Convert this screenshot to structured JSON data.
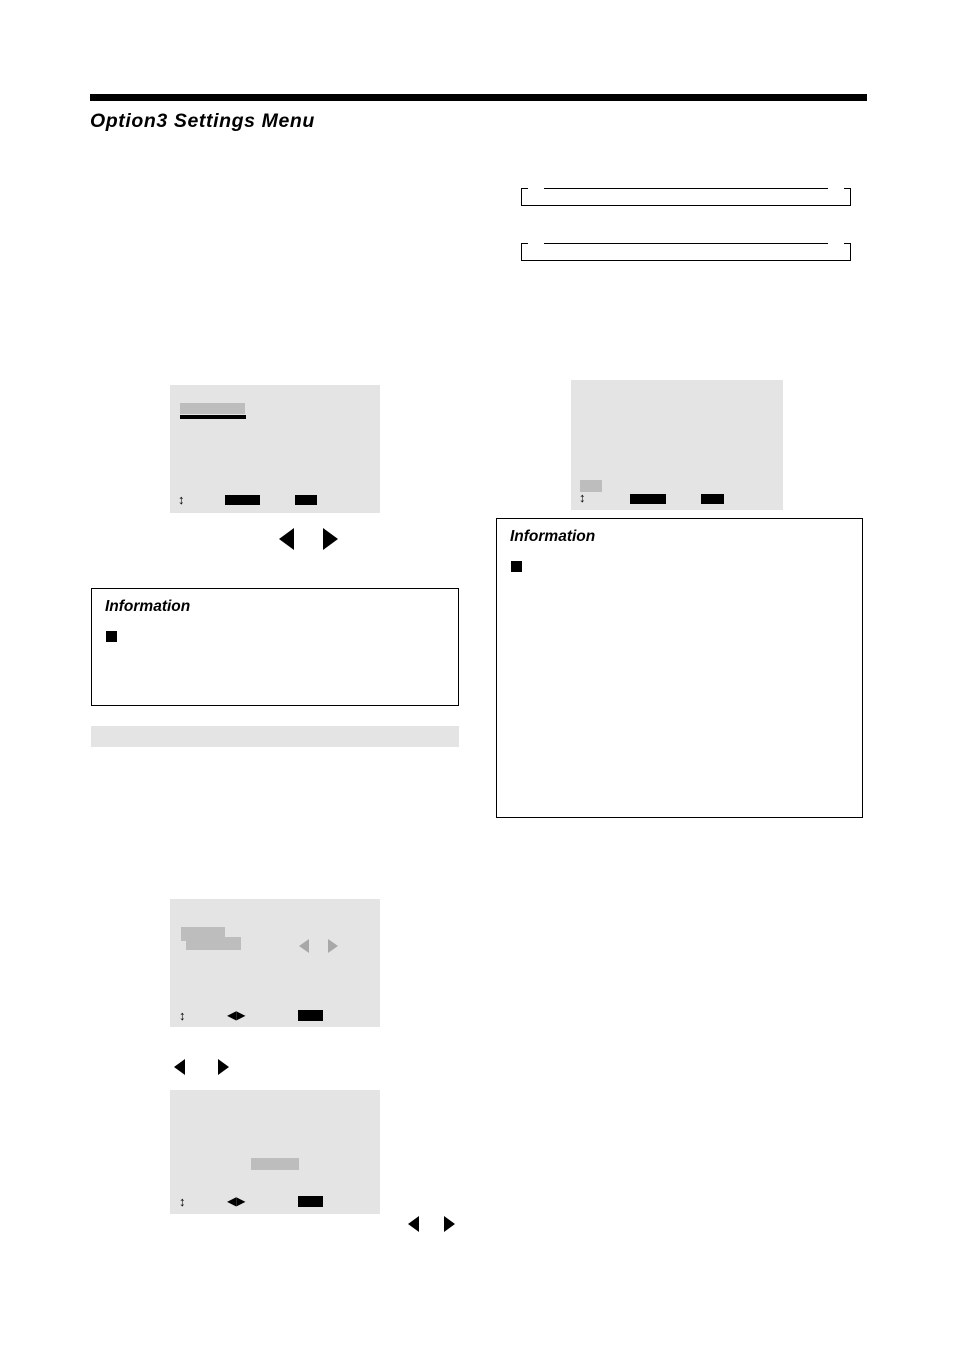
{
  "page": {
    "title": "Option3 Settings Menu",
    "rule_present": true
  },
  "note_boxes": [
    {
      "text": ""
    },
    {
      "text": ""
    }
  ],
  "section_bar": {
    "text": ""
  },
  "paragraphs": {
    "left_intro": "",
    "left_mid": "",
    "right_intro": "",
    "below_panel3": "",
    "below_panel4": ""
  },
  "information_boxes": [
    {
      "name": "information-left",
      "title": "Information",
      "bullet": "■",
      "body": ""
    },
    {
      "name": "information-right",
      "title": "Information",
      "bullet": "■",
      "body": ""
    }
  ],
  "osd_panels": [
    {
      "name": "osd-panel-1",
      "selected_row_label": "",
      "footer": {
        "updown_glyph": "↕",
        "action_1_label": "",
        "action_2_label": ""
      }
    },
    {
      "name": "osd-panel-2",
      "selected_row_label": "",
      "footer": {
        "updown_glyph": "↕",
        "action_1_label": "",
        "action_2_label": ""
      }
    },
    {
      "name": "osd-panel-3",
      "selected_row_label": "",
      "selected_value_label": "",
      "adjust_left_glyph": "◀",
      "adjust_right_glyph": "▶",
      "footer": {
        "updown_glyph": "↕",
        "leftright_glyph": "◀▶",
        "action_label": ""
      }
    },
    {
      "name": "osd-panel-4",
      "selected_value_label": "",
      "footer": {
        "updown_glyph": "↕",
        "leftright_glyph": "◀▶",
        "action_label": ""
      }
    }
  ],
  "nav_arrows": [
    {
      "name": "nav-arrows-under-panel-1",
      "left": "◀",
      "right": "▶"
    },
    {
      "name": "nav-arrows-under-panel-3",
      "left": "◀",
      "right": "▶"
    },
    {
      "name": "nav-arrows-under-panel-4",
      "left": "◀",
      "right": "▶"
    }
  ],
  "colors": {
    "panel_bg": "#e4e4e4",
    "highlight": "#bdbdbd",
    "ink": "#000000",
    "paper": "#ffffff"
  }
}
